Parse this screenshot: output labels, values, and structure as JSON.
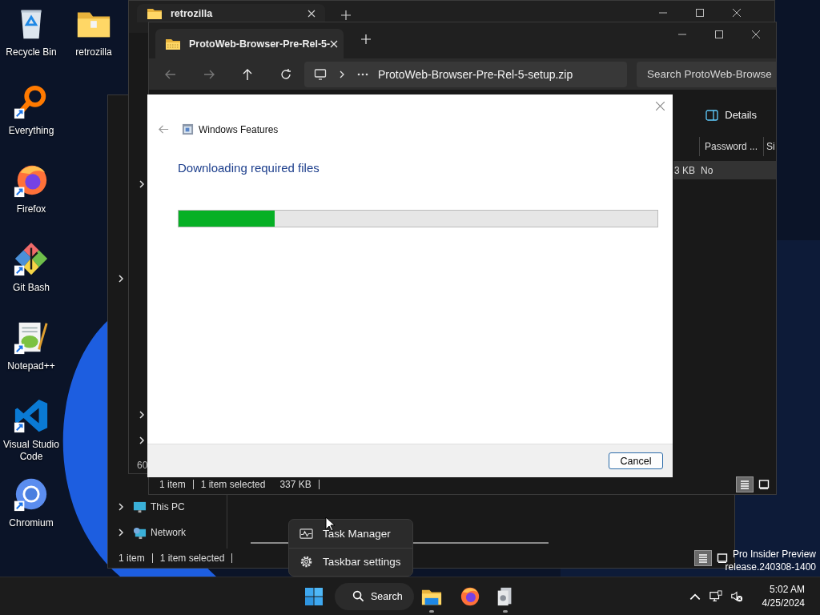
{
  "desktop_icons": [
    {
      "label": "Recycle Bin",
      "kind": "recycle",
      "shortcut": false
    },
    {
      "label": "Everything",
      "kind": "everything",
      "shortcut": true
    },
    {
      "label": "Firefox",
      "kind": "firefox",
      "shortcut": true
    },
    {
      "label": "Git Bash",
      "kind": "git",
      "shortcut": true
    },
    {
      "label": "Notepad++",
      "kind": "notepad",
      "shortcut": true
    },
    {
      "label": "Visual Studio Code",
      "kind": "vscode",
      "shortcut": true
    },
    {
      "label": "Chromium",
      "kind": "chromium",
      "shortcut": true
    },
    {
      "label": "retrozilla",
      "kind": "folder",
      "shortcut": false
    }
  ],
  "back_window": {
    "nav_items": [
      {
        "label": "This PC",
        "kind": "pc"
      },
      {
        "label": "Network",
        "kind": "network"
      }
    ],
    "status": [
      "1 item",
      "1 item selected"
    ],
    "views": [
      {
        "kind": "details",
        "selected": true
      },
      {
        "kind": "tiles",
        "selected": false
      }
    ]
  },
  "middle_window": {
    "tab": "retrozilla",
    "status_count": "60"
  },
  "front_window": {
    "tab": "ProtoWeb-Browser-Pre-Rel-5-",
    "path": "ProtoWeb-Browser-Pre-Rel-5-setup.zip",
    "search": {
      "placeholder": "Search ProtoWeb-Browse"
    },
    "details_button": "Details",
    "columns": [
      "",
      "Password ...",
      "Si"
    ],
    "rows": [
      {
        "cells": [
          "3 KB",
          "No"
        ],
        "selected": true
      }
    ],
    "status": [
      "1 item",
      "1 item selected",
      "337 KB"
    ],
    "views": [
      {
        "kind": "details",
        "selected": true
      },
      {
        "kind": "tiles",
        "selected": false
      }
    ]
  },
  "dialog": {
    "title": "Windows Features",
    "heading": "Downloading required files",
    "progress": {
      "level": 0.2
    },
    "buttons": [
      "Cancel"
    ]
  },
  "context_menu": [
    {
      "label": "Task Manager",
      "kind": "task-manager"
    },
    {
      "label": "Taskbar settings",
      "kind": "settings"
    }
  ],
  "watermark_lines": [
    "Pro Insider Preview",
    "release.240308-1400"
  ],
  "taskbar": {
    "search": "Search",
    "apps": [
      {
        "kind": "explorer",
        "running": true
      },
      {
        "kind": "firefox",
        "running": false
      },
      {
        "kind": "installer",
        "running": true
      }
    ],
    "time": "5:02 AM",
    "date": "4/25/2024"
  }
}
